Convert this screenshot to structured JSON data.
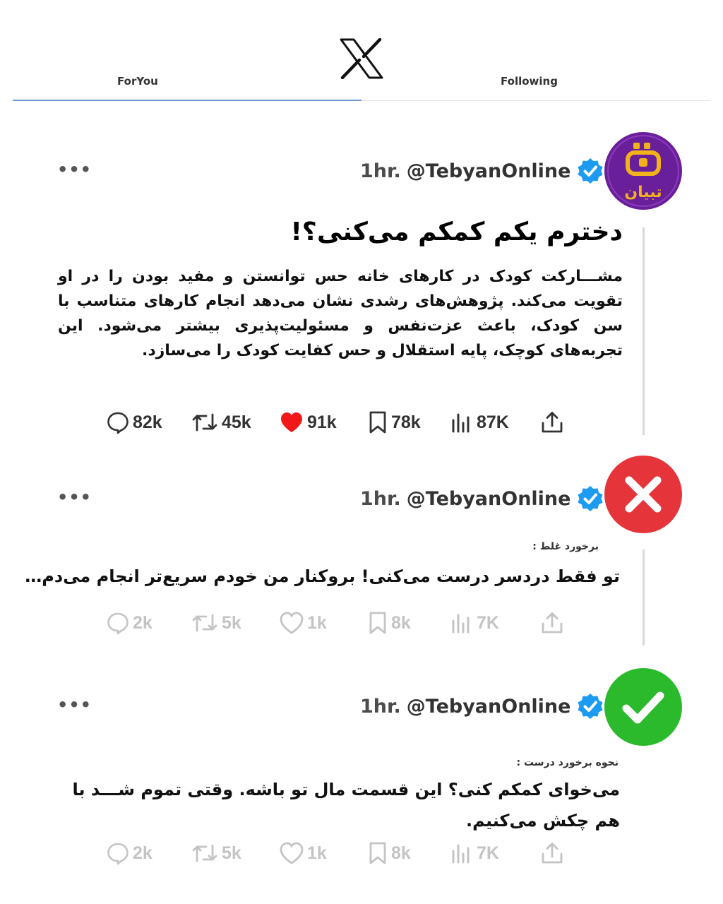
{
  "tabs": {
    "for_you": "ForYou",
    "following": "Following"
  },
  "logo_icon": "x-logo-icon",
  "colors": {
    "verified": "#1d9bf0",
    "like": "#f01818",
    "error": "#e5353b",
    "success": "#2bba2b",
    "avatar": "#6a1f9a",
    "avatar_accent": "#f2b21a",
    "tab_indicator": "#6f9bd3"
  },
  "tweets": [
    {
      "time": "1hr.",
      "handle": "@TebyanOnline",
      "avatar_text": "تبیان",
      "title": "دخترم یکم کمکم می‌کنی؟!",
      "body": "مشـــارکت کودک در کارهای خانه حس توانستن و مفید بودن را در او تقویت می‌کند. پژوهش‌های رشدی نشان می‌دهد انجام کارهای متناسب با سن کودک، باعث عزت‌نفس و مسئولیت‌پذیری بیشتر می‌شود. این تجربه‌های کوچک، پایه استقلال و حس کفایت کودک را می‌سازد.",
      "stats": {
        "replies": "82k",
        "retweets": "45k",
        "likes": "91k",
        "bookmarks": "78k",
        "views": "87K"
      }
    },
    {
      "time": "1hr.",
      "handle": "@TebyanOnline",
      "badge_icon": "x-mark-icon",
      "label": "برخورد غلط :",
      "text": "تو فقط دردسر درست می‌کنی! بروکنار من خودم سریع‌تر انجام می‌دم…",
      "stats": {
        "replies": "2k",
        "retweets": "5k",
        "likes": "1k",
        "bookmarks": "8k",
        "views": "7K"
      }
    },
    {
      "time": "1hr.",
      "handle": "@TebyanOnline",
      "badge_icon": "check-mark-icon",
      "label": "نحوه برخورد درست :",
      "text": "می‌خوای کمکم کنی؟ این قسمت مال تو باشه. وقتی تموم شـــد با هم چکش می‌کنیم.",
      "stats": {
        "replies": "2k",
        "retweets": "5k",
        "likes": "1k",
        "bookmarks": "8k",
        "views": "7K"
      }
    }
  ]
}
